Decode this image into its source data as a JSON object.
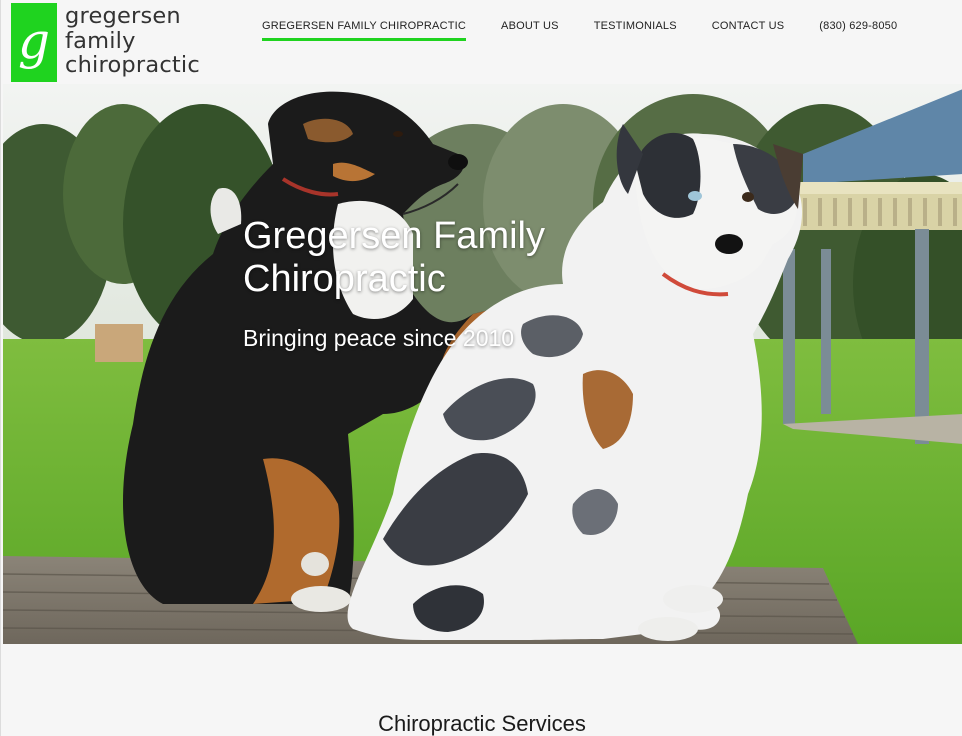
{
  "brand": {
    "logo_letter": "g",
    "logo_line1": "gregersen",
    "logo_line2": "family",
    "logo_line3": "chiropractic",
    "accent_color": "#1fd31f"
  },
  "nav": {
    "items": [
      {
        "label": "GREGERSEN FAMILY CHIROPRACTIC",
        "active": true
      },
      {
        "label": "ABOUT US",
        "active": false
      },
      {
        "label": "TESTIMONIALS",
        "active": false
      },
      {
        "label": "CONTACT US",
        "active": false
      },
      {
        "label": "(830) 629-8050",
        "active": false
      }
    ]
  },
  "hero": {
    "title": "Gregersen Family Chiropractic",
    "subtitle": "Bringing peace since 2010"
  },
  "services": {
    "heading": "Chiropractic Services"
  }
}
